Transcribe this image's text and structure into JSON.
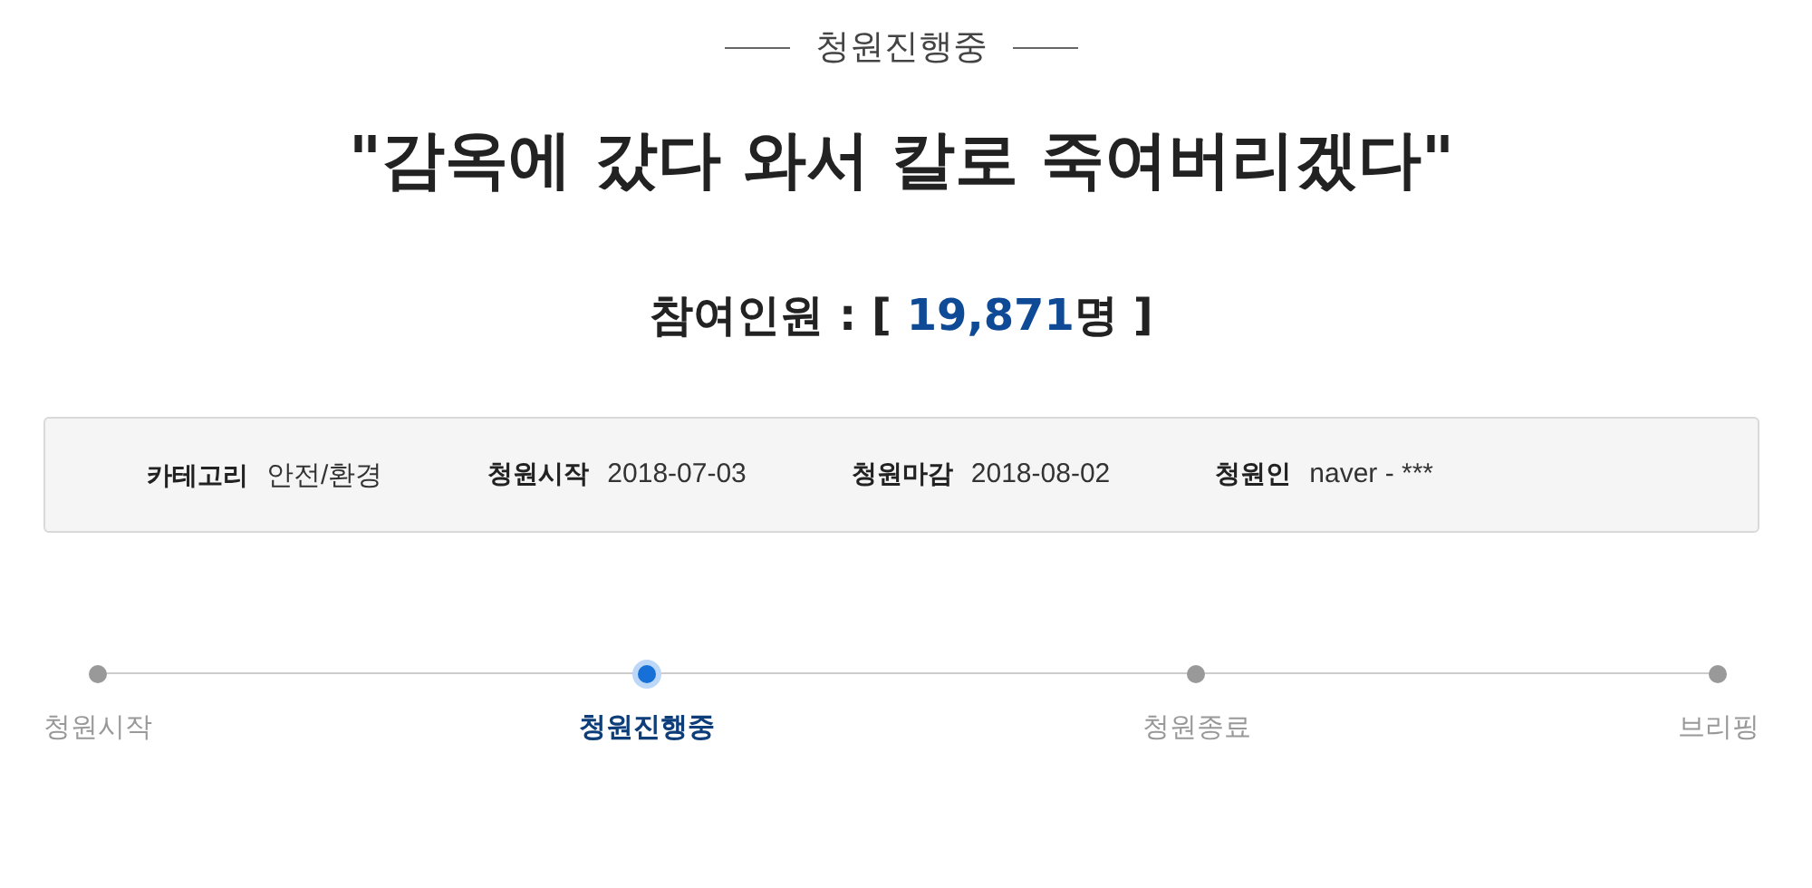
{
  "status_heading": "청원진행중",
  "title": "\"감옥에 갔다 와서 칼로 죽여버리겠다\"",
  "participants": {
    "label": "참여인원 :",
    "open": "[",
    "count": "19,871",
    "unit": "명",
    "close": "]"
  },
  "info": [
    {
      "label": "카테고리",
      "value": "안전/환경"
    },
    {
      "label": "청원시작",
      "value": "2018-07-03"
    },
    {
      "label": "청원마감",
      "value": "2018-08-02"
    },
    {
      "label": "청원인",
      "value": "naver - ***"
    }
  ],
  "steps": [
    {
      "label": "청원시작",
      "selected": false
    },
    {
      "label": "청원진행중",
      "selected": true
    },
    {
      "label": "청원종료",
      "selected": false
    },
    {
      "label": "브리핑",
      "selected": false
    }
  ]
}
